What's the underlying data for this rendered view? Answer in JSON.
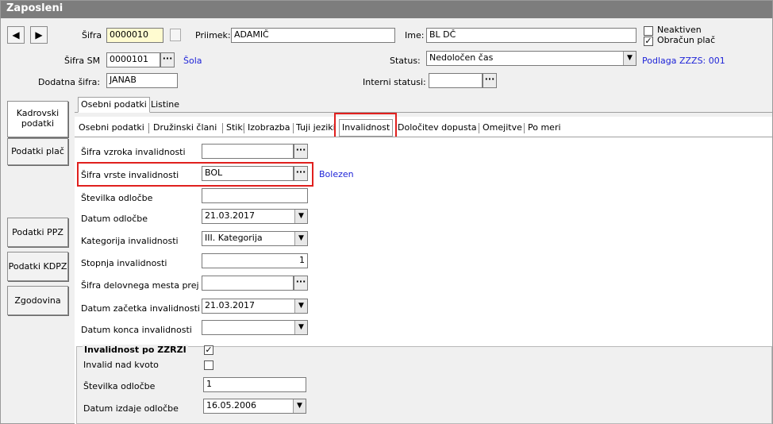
{
  "window": {
    "title": "Zaposleni"
  },
  "nav": {
    "prev": "◀",
    "next": "▶"
  },
  "header": {
    "sifra_label": "Šifra",
    "sifra_value": "0000010",
    "priimek_label": "Priimek:",
    "priimek_value": "ADAMIČ",
    "ime_label": "Ime:",
    "ime_value": "BL DČ",
    "neaktiven_label": "Neaktiven",
    "neaktiven_checked": false,
    "obracun_label": "Obračun plač",
    "obracun_checked": true,
    "sifra_sm_label": "Šifra SM",
    "sifra_sm_value": "0000101",
    "sm_link": "Šola",
    "status_label": "Status:",
    "status_value": "Nedoločen čas",
    "podlaga_link": "Podlaga ZZZS: 001",
    "dodatna_label": "Dodatna šifra:",
    "dodatna_value": "JANAB",
    "interni_label": "Interni statusi:",
    "interni_value": ""
  },
  "sidebar": {
    "kadrovski_1": "Kadrovski",
    "kadrovski_2": "podatki",
    "podatki_plac": "Podatki plač",
    "podatki_ppz": "Podatki PPZ",
    "podatki_kdpz": "Podatki KDPZ",
    "zgodovina": "Zgodovina"
  },
  "tabs_top": {
    "osebni": "Osebni podatki",
    "listine": "Listine"
  },
  "tabs_sub": {
    "osebni": "Osebni podatki",
    "druzinski": "Družinski člani",
    "stiki": "Stiki",
    "izobrazba": "Izobrazba",
    "tuji": "Tuji jeziki",
    "invalidnost": "Invalidnost",
    "dolocitev": "Določitev dopusta",
    "omejitve": "Omejitve",
    "po_meri": "Po meri"
  },
  "form": {
    "vzrok_label": "Šifra vzroka invalidnosti",
    "vzrok_value": "",
    "vrsta_label": "Šifra vrste invalidnosti",
    "vrsta_value": "BOL",
    "vrsta_desc": "Bolezen",
    "odlocba_label": "Številka odločbe",
    "odlocba_value": "",
    "datum_odlocbe_label": "Datum odločbe",
    "datum_odlocbe_value": "21.03.2017",
    "kategorija_label": "Kategorija invalidnosti",
    "kategorija_value": "III. Kategorija",
    "stopnja_label": "Stopnja invalidnosti",
    "stopnja_value": "1",
    "delovno_label": "Šifra delovnega mesta prej",
    "delovno_value": "",
    "zacetek_label": "Datum začetka invalidnosti",
    "zacetek_value": "21.03.2017",
    "konec_label": "Datum konca invalidnosti",
    "konec_value": ""
  },
  "zzrzi": {
    "title": "Invalidnost po ZZRZI",
    "checked": true,
    "nad_kvoto_label": "Invalid nad kvoto",
    "nad_kvoto_checked": false,
    "odlocba_label": "Številka odločbe",
    "odlocba_value": "1",
    "datum_label": "Datum izdaje odločbe",
    "datum_value": "16.05.2006"
  },
  "colors": {
    "highlight": "#e0201e",
    "link": "#1f24d8",
    "titlebar": "#7d7d7d"
  }
}
